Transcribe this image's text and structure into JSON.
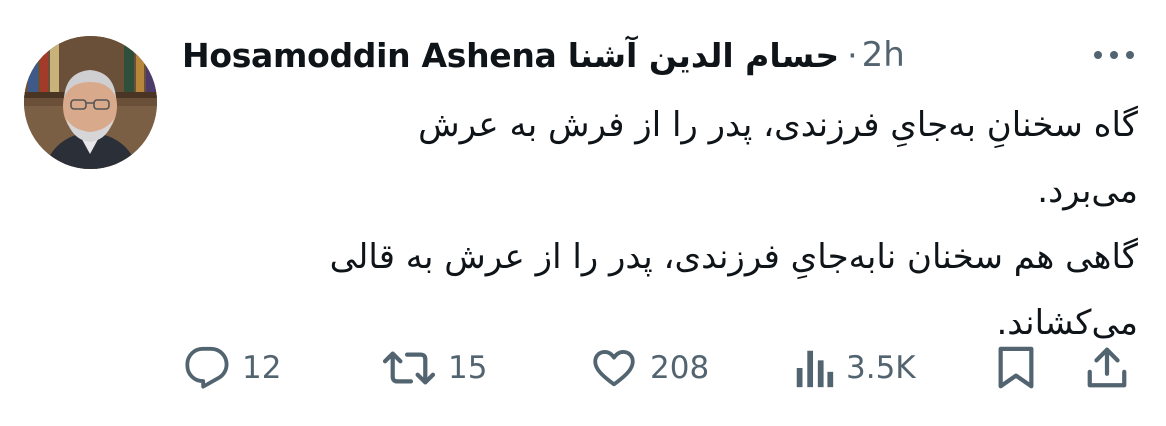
{
  "author": {
    "display_name": "Hosamoddin Ashena حسام الدین آشنا",
    "separator": "·",
    "timestamp": "2h",
    "avatar_icon": "user-avatar-photo"
  },
  "tweet": {
    "lines": [
      "گاه  سخنانِ  به‌جایِ فرزندی، پدر را از فرش به عرش",
      "می‌برد.",
      "گاهی هم سخنان نابه‌جایِ فرزندی، پدر را  از عرش به قالی",
      "می‌کشاند."
    ]
  },
  "actions": {
    "reply": {
      "icon": "reply-icon",
      "count": "12"
    },
    "retweet": {
      "icon": "retweet-icon",
      "count": "15"
    },
    "like": {
      "icon": "heart-icon",
      "count": "208"
    },
    "views": {
      "icon": "views-icon",
      "count": "3.5K"
    },
    "bookmark": {
      "icon": "bookmark-icon"
    },
    "share": {
      "icon": "share-icon"
    }
  },
  "colors": {
    "text_primary": "#0f1419",
    "text_secondary": "#536471",
    "background": "#ffffff"
  }
}
